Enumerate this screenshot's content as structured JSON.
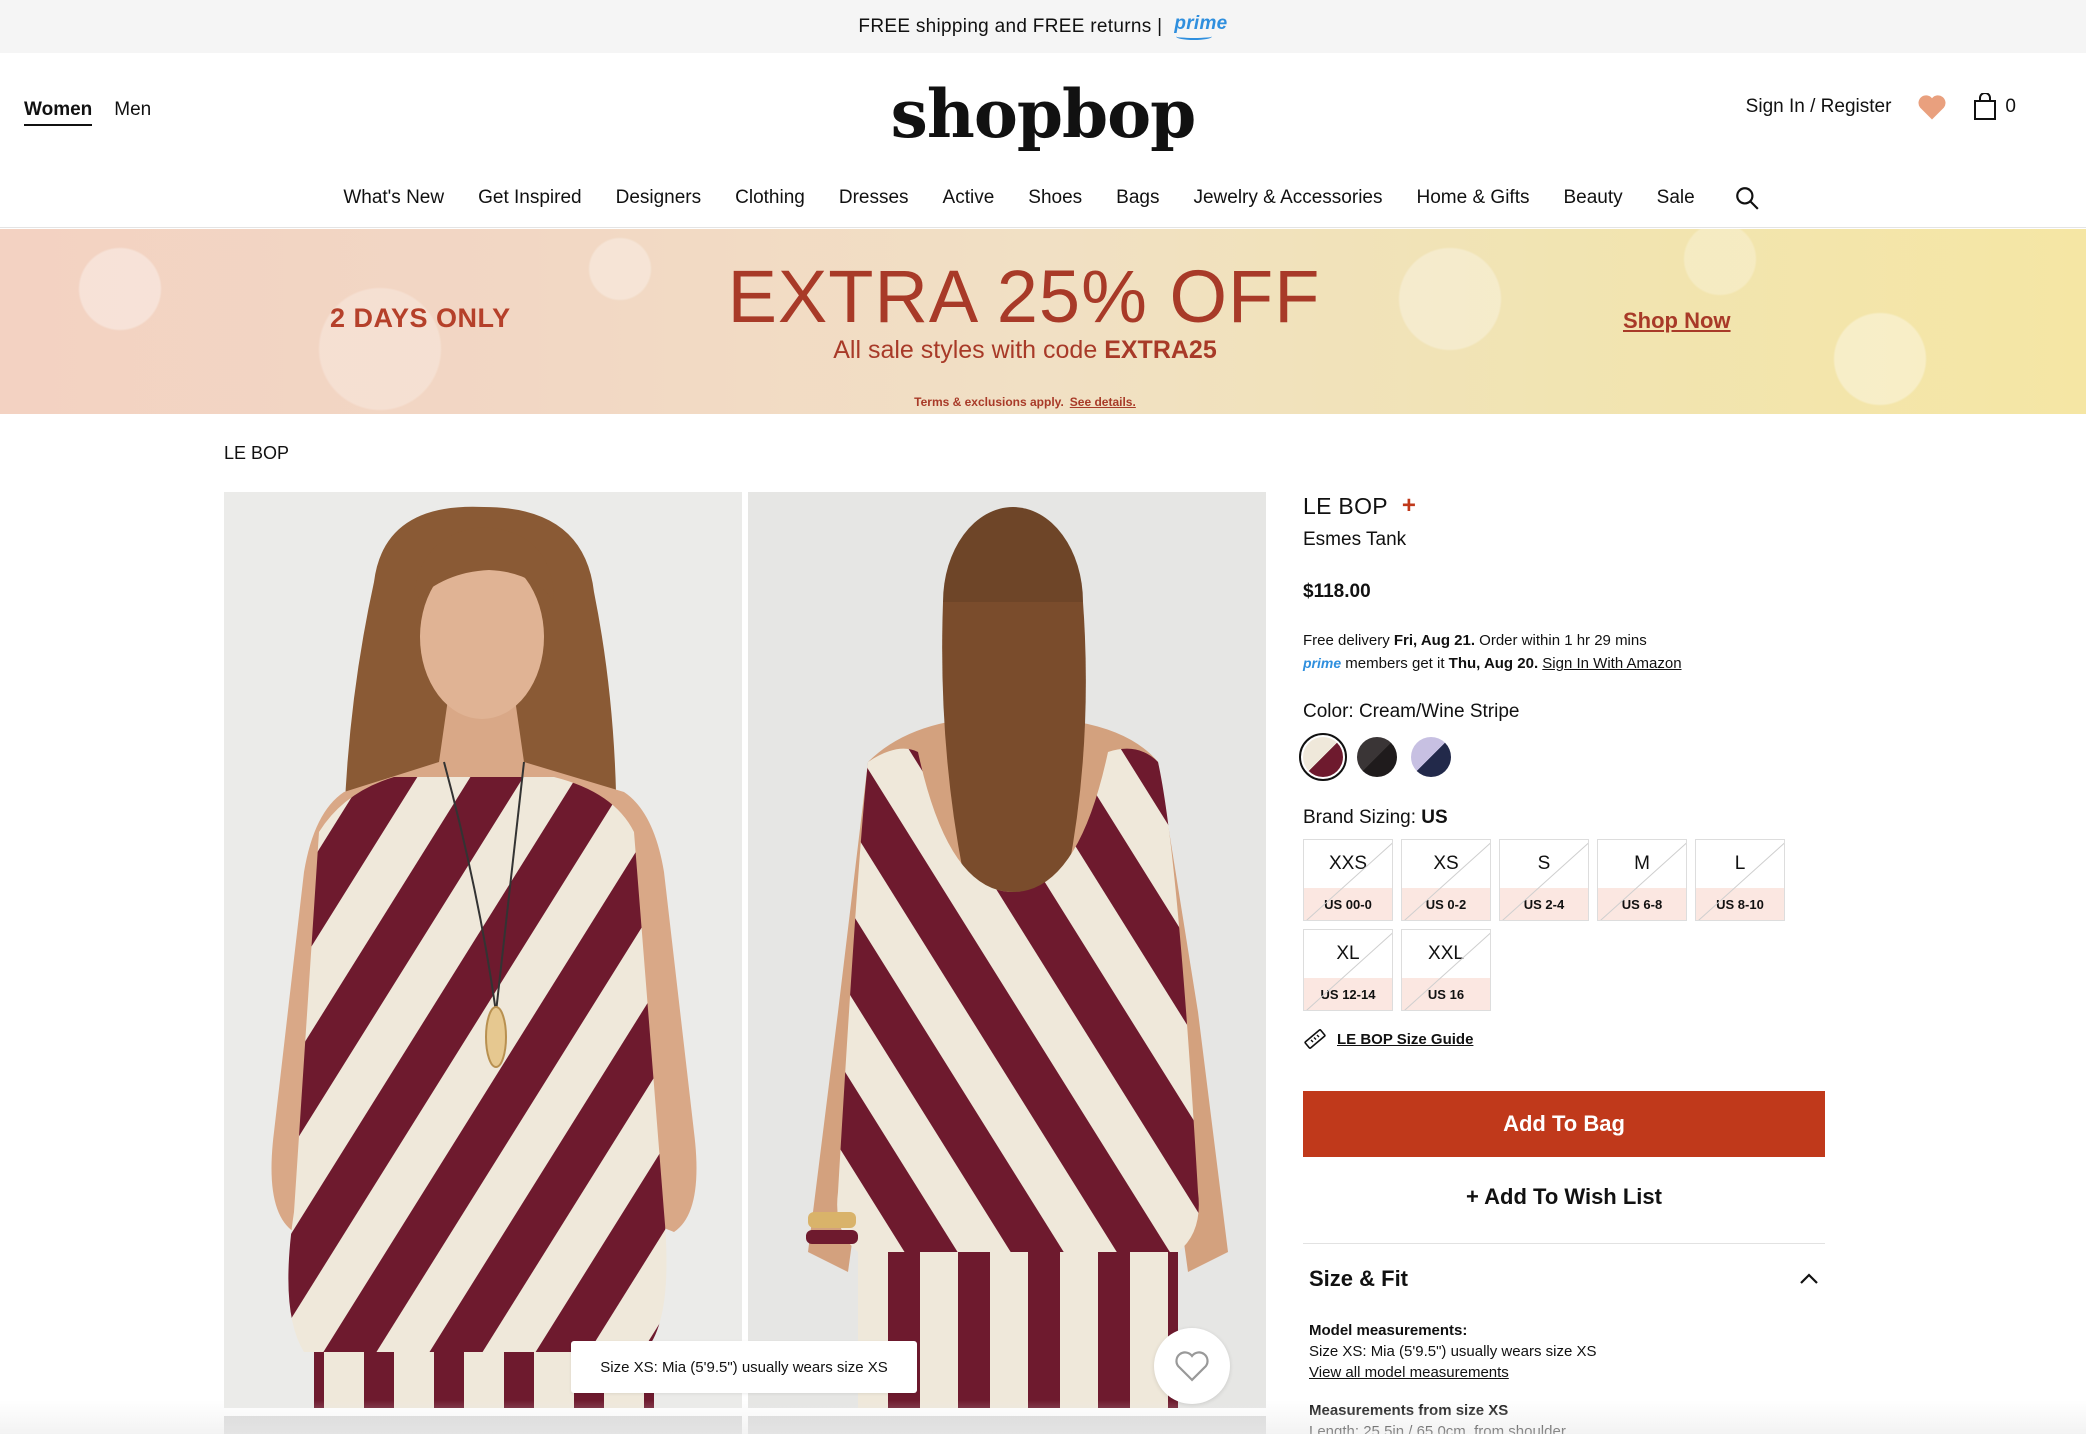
{
  "topbar": {
    "text": "FREE shipping and FREE returns |",
    "prime_logo": "prime"
  },
  "header": {
    "gender_tabs": [
      "Women",
      "Men"
    ],
    "logo": "shopbop",
    "sign_in": "Sign In / Register",
    "bag_count": "0",
    "nav": [
      "What's New",
      "Get Inspired",
      "Designers",
      "Clothing",
      "Dresses",
      "Active",
      "Shoes",
      "Bags",
      "Jewelry & Accessories",
      "Home & Gifts",
      "Beauty",
      "Sale"
    ]
  },
  "banner": {
    "left": "2 DAYS ONLY",
    "headline": "EXTRA 25% OFF",
    "sub_text": "All sale styles with code",
    "code": "EXTRA25",
    "cta": "Shop Now",
    "terms": "Terms & exclusions apply.",
    "terms_link": "See details."
  },
  "breadcrumb": "LE BOP",
  "gallery": {
    "tooltip": "Size XS: Mia (5'9.5\") usually wears size XS"
  },
  "product": {
    "brand": "LE BOP",
    "name": "Esmes Tank",
    "price": "$118.00",
    "delivery_prefix": "Free delivery",
    "delivery_date": "Fri, Aug 21.",
    "delivery_suffix": "Order within 1 hr 29 mins",
    "prime_label": "prime",
    "prime_text": "members get it",
    "prime_date": "Thu, Aug 20.",
    "prime_link": "Sign In With Amazon",
    "color_label": "Color: Cream/Wine Stripe",
    "sizing_label": "Brand Sizing:",
    "sizing_system": "US",
    "sizes": [
      {
        "size": "XXS",
        "us": "US 00-0"
      },
      {
        "size": "XS",
        "us": "US 0-2"
      },
      {
        "size": "S",
        "us": "US 2-4"
      },
      {
        "size": "M",
        "us": "US 6-8"
      },
      {
        "size": "L",
        "us": "US 8-10"
      },
      {
        "size": "XL",
        "us": "US 12-14"
      },
      {
        "size": "XXL",
        "us": "US 16"
      }
    ],
    "size_guide": "LE BOP Size Guide",
    "add_to_bag": "Add To Bag",
    "add_to_wish": "+ Add To Wish List",
    "size_fit": {
      "title": "Size & Fit",
      "model_heading": "Model measurements:",
      "model_text": "Size XS: Mia (5'9.5\") usually wears size XS",
      "model_link": "View all model measurements",
      "meas_heading": "Measurements from size XS",
      "meas_text": "Length: 25.5in / 65.0cm, from shoulder"
    }
  },
  "colors": {
    "accent": "#c0391b",
    "prime": "#2f8fde",
    "wine": "#6e1a2e",
    "cream": "#efe8da"
  }
}
